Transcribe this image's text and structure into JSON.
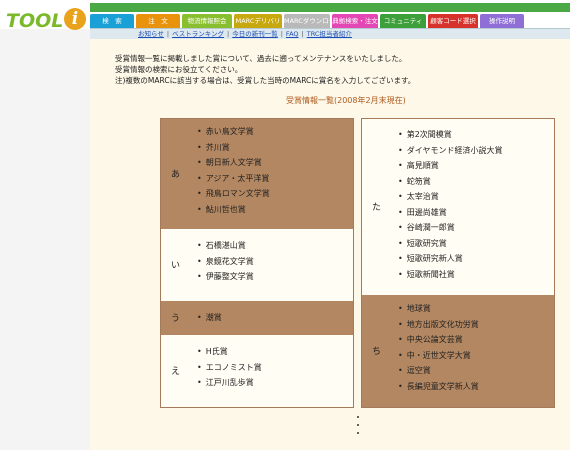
{
  "logo": {
    "text": "TOOL",
    "badge": "i"
  },
  "colors": {
    "topbar": "#4aa845",
    "dark_section": "#b38761",
    "heading": "#b05a1e",
    "link": "#1d4db3"
  },
  "tabs": [
    {
      "label": "検　索",
      "color": "#19a0d6"
    },
    {
      "label": "注　文",
      "color": "#e9920c"
    },
    {
      "label": "物流情報照会",
      "color": "#89bf2f"
    },
    {
      "label": "MARCデリバリ",
      "color": "#c8a80f"
    },
    {
      "label": "MARCダウンロード",
      "color": "#b9b9b9"
    },
    {
      "label": "典拠検索・注文",
      "color": "#e347b3"
    },
    {
      "label": "コミュニティ",
      "color": "#3c9f3a"
    },
    {
      "label": "顧客コード選択",
      "color": "#d6312a"
    },
    {
      "label": "操作説明",
      "color": "#8f6fd6"
    }
  ],
  "subnav": [
    "お知らせ",
    "ベストランキング",
    "今日の新刊一覧",
    "FAQ",
    "TRC担当者紹介"
  ],
  "intro": [
    "受賞情報一覧に掲載しました賞について、過去に遡ってメンテナンスをいたしました。",
    "受賞情報の検索にお役立てください。",
    "注)複数のMARCに該当する場合は、受賞した当時のMARCに賞名を入力してございます。"
  ],
  "heading": "受賞情報一覧(2008年2月末現在)",
  "left_column": [
    {
      "kana": "あ",
      "items": [
        "赤い鳥文学賞",
        "芥川賞",
        "朝日新人文学賞",
        "アジア・太平洋賞",
        "飛鳥ロマン文学賞",
        "鮎川哲也賞"
      ]
    },
    {
      "kana": "い",
      "items": [
        "石橋湛山賞",
        "泉鏡花文学賞",
        "伊藤整文学賞"
      ]
    },
    {
      "kana": "う",
      "items": [
        "潮賞"
      ]
    },
    {
      "kana": "え",
      "items": [
        "H氏賞",
        "エコノミスト賞",
        "江戸川乱歩賞"
      ]
    }
  ],
  "right_column": [
    {
      "kana": "た",
      "items": [
        "第2次間模賞",
        "ダイヤモンド経済小説大賞",
        "高見順賞",
        "蛇笏賞",
        "太宰治賞",
        "田邊尚雄賞",
        "谷崎潤一郎賞",
        "短歌研究賞",
        "短歌研究新人賞",
        "短歌新聞社賞"
      ]
    },
    {
      "kana": "ち",
      "items": [
        "地球賞",
        "地方出版文化功労賞",
        "中央公論文芸賞",
        "中・近世文学大賞",
        "逗空賞",
        "長編児童文学新人賞"
      ]
    }
  ]
}
